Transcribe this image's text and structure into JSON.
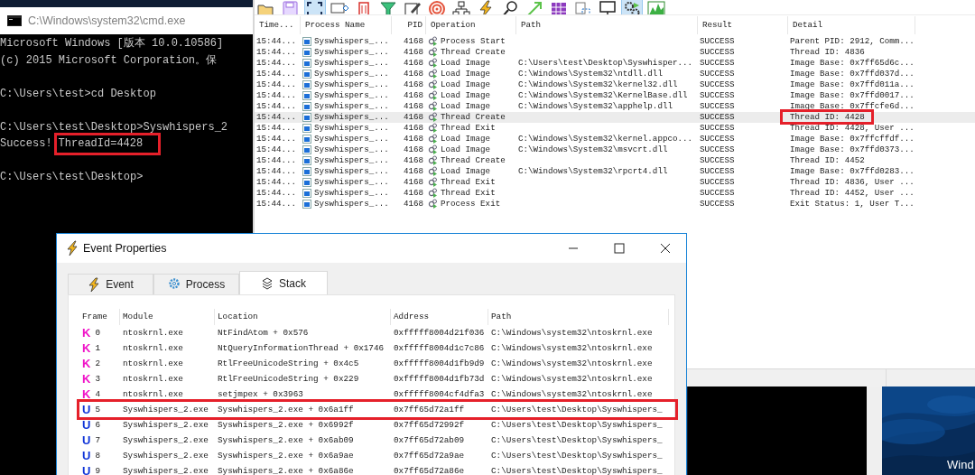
{
  "cmd": {
    "title": "C:\\Windows\\system32\\cmd.exe",
    "blocks": [
      [
        [
          {
            "text": "Microsoft Windows [版本 10.0.10586]",
            "highlighted": false
          }
        ],
        [
          {
            "text": "(c) 2015 Microsoft Corporation。保",
            "highlighted": false
          }
        ]
      ],
      [
        [
          {
            "text": "C:\\Users\\test>cd Desktop",
            "highlighted": false
          }
        ]
      ],
      [
        [
          {
            "text": "C:\\Users\\test\\Desktop>Syswhispers_2",
            "highlighted": false
          }
        ],
        [
          {
            "text": "Success!",
            "highlighted": false
          },
          {
            "text": "ThreadId=4428",
            "highlighted": true
          }
        ]
      ],
      [
        [
          {
            "text": "C:\\Users\\test\\Desktop>",
            "highlighted": false
          }
        ]
      ]
    ]
  },
  "procmon": {
    "toolbar": [
      {
        "kind": "folder",
        "selected": false
      },
      {
        "kind": "save",
        "selected": false
      },
      {
        "kind": "capture",
        "selected": true
      },
      {
        "kind": "autoscroll",
        "selected": false
      },
      {
        "kind": "clear",
        "selected": false
      },
      {
        "kind": "filter",
        "selected": false
      },
      {
        "kind": "highlight",
        "selected": false
      },
      {
        "kind": "target",
        "selected": false
      },
      {
        "kind": "tree",
        "selected": false
      },
      {
        "kind": "events",
        "selected": false
      },
      {
        "kind": "find",
        "selected": false
      },
      {
        "kind": "jump",
        "selected": false
      },
      {
        "kind": "registry",
        "selected": false
      },
      {
        "kind": "files",
        "selected": false
      },
      {
        "kind": "network",
        "selected": false
      },
      {
        "kind": "process",
        "selected": true
      },
      {
        "kind": "profiling",
        "selected": false
      }
    ],
    "columns": [
      "Time...",
      "Process Name",
      "PID",
      "Operation",
      "Path",
      "Result",
      "Detail"
    ],
    "rows": [
      {
        "time": "15:44...",
        "process": "Syswhispers_...",
        "pid": "4168",
        "operation": "Process Start",
        "path": "",
        "result": "SUCCESS",
        "detail": "Parent PID: 2912, Comm...",
        "selected": false,
        "highlighted": false
      },
      {
        "time": "15:44...",
        "process": "Syswhispers_...",
        "pid": "4168",
        "operation": "Thread Create",
        "path": "",
        "result": "SUCCESS",
        "detail": "Thread ID: 4836",
        "selected": false,
        "highlighted": false
      },
      {
        "time": "15:44...",
        "process": "Syswhispers_...",
        "pid": "4168",
        "operation": "Load Image",
        "path": "C:\\Users\\test\\Desktop\\Syswhisper...",
        "result": "SUCCESS",
        "detail": "Image Base: 0x7ff65d6c...",
        "selected": false,
        "highlighted": false
      },
      {
        "time": "15:44...",
        "process": "Syswhispers_...",
        "pid": "4168",
        "operation": "Load Image",
        "path": "C:\\Windows\\System32\\ntdll.dll",
        "result": "SUCCESS",
        "detail": "Image Base: 0x7ffd037d...",
        "selected": false,
        "highlighted": false
      },
      {
        "time": "15:44...",
        "process": "Syswhispers_...",
        "pid": "4168",
        "operation": "Load Image",
        "path": "C:\\Windows\\System32\\kernel32.dll",
        "result": "SUCCESS",
        "detail": "Image Base: 0x7ffd011a...",
        "selected": false,
        "highlighted": false
      },
      {
        "time": "15:44...",
        "process": "Syswhispers_...",
        "pid": "4168",
        "operation": "Load Image",
        "path": "C:\\Windows\\System32\\KernelBase.dll",
        "result": "SUCCESS",
        "detail": "Image Base: 0x7ffd0017...",
        "selected": false,
        "highlighted": false
      },
      {
        "time": "15:44...",
        "process": "Syswhispers_...",
        "pid": "4168",
        "operation": "Load Image",
        "path": "C:\\Windows\\System32\\apphelp.dll",
        "result": "SUCCESS",
        "detail": "Image Base: 0x7ffcfe6d...",
        "selected": false,
        "highlighted": false
      },
      {
        "time": "15:44...",
        "process": "Syswhispers_...",
        "pid": "4168",
        "operation": "Thread Create",
        "path": "",
        "result": "SUCCESS",
        "detail": "Thread ID: 4428",
        "selected": true,
        "highlighted": true
      },
      {
        "time": "15:44...",
        "process": "Syswhispers_...",
        "pid": "4168",
        "operation": "Thread Exit",
        "path": "",
        "result": "SUCCESS",
        "detail": "Thread ID: 4428, User ...",
        "selected": false,
        "highlighted": false
      },
      {
        "time": "15:44...",
        "process": "Syswhispers_...",
        "pid": "4168",
        "operation": "Load Image",
        "path": "C:\\Windows\\System32\\kernel.appco...",
        "result": "SUCCESS",
        "detail": "Image Base: 0x7ffcffdf...",
        "selected": false,
        "highlighted": false
      },
      {
        "time": "15:44...",
        "process": "Syswhispers_...",
        "pid": "4168",
        "operation": "Load Image",
        "path": "C:\\Windows\\System32\\msvcrt.dll",
        "result": "SUCCESS",
        "detail": "Image Base: 0x7ffd0373...",
        "selected": false,
        "highlighted": false
      },
      {
        "time": "15:44...",
        "process": "Syswhispers_...",
        "pid": "4168",
        "operation": "Thread Create",
        "path": "",
        "result": "SUCCESS",
        "detail": "Thread ID: 4452",
        "selected": false,
        "highlighted": false
      },
      {
        "time": "15:44...",
        "process": "Syswhispers_...",
        "pid": "4168",
        "operation": "Load Image",
        "path": "C:\\Windows\\System32\\rpcrt4.dll",
        "result": "SUCCESS",
        "detail": "Image Base: 0x7ffd0283...",
        "selected": false,
        "highlighted": false
      },
      {
        "time": "15:44...",
        "process": "Syswhispers_...",
        "pid": "4168",
        "operation": "Thread Exit",
        "path": "",
        "result": "SUCCESS",
        "detail": "Thread ID: 4836, User ...",
        "selected": false,
        "highlighted": false
      },
      {
        "time": "15:44...",
        "process": "Syswhispers_...",
        "pid": "4168",
        "operation": "Thread Exit",
        "path": "",
        "result": "SUCCESS",
        "detail": "Thread ID: 4452, User ...",
        "selected": false,
        "highlighted": false
      },
      {
        "time": "15:44...",
        "process": "Syswhispers_...",
        "pid": "4168",
        "operation": "Process Exit",
        "path": "",
        "result": "SUCCESS",
        "detail": "Exit Status: 1, User T...",
        "selected": false,
        "highlighted": false
      }
    ]
  },
  "event_properties": {
    "title": "Event Properties",
    "tabs": [
      {
        "label": "Event",
        "kind": "event",
        "selected": false
      },
      {
        "label": "Process",
        "kind": "process",
        "selected": false
      },
      {
        "label": "Stack",
        "kind": "stack",
        "selected": true
      }
    ],
    "columns": [
      "Frame",
      "Module",
      "Location",
      "Address",
      "Path"
    ],
    "rows": [
      {
        "kind": "kernel",
        "mode": "K",
        "frame": "0",
        "module": "ntoskrnl.exe",
        "location": "NtFindAtom + 0x576",
        "address": "0xfffff8004d21f036",
        "path": "C:\\Windows\\system32\\ntoskrnl.exe",
        "highlighted": false
      },
      {
        "kind": "kernel",
        "mode": "K",
        "frame": "1",
        "module": "ntoskrnl.exe",
        "location": "NtQueryInformationThread + 0x1746",
        "address": "0xfffff8004d1c7c86",
        "path": "C:\\Windows\\system32\\ntoskrnl.exe",
        "highlighted": false
      },
      {
        "kind": "kernel",
        "mode": "K",
        "frame": "2",
        "module": "ntoskrnl.exe",
        "location": "RtlFreeUnicodeString + 0x4c5",
        "address": "0xfffff8004d1fb9d9",
        "path": "C:\\Windows\\system32\\ntoskrnl.exe",
        "highlighted": false
      },
      {
        "kind": "kernel",
        "mode": "K",
        "frame": "3",
        "module": "ntoskrnl.exe",
        "location": "RtlFreeUnicodeString + 0x229",
        "address": "0xfffff8004d1fb73d",
        "path": "C:\\Windows\\system32\\ntoskrnl.exe",
        "highlighted": false
      },
      {
        "kind": "kernel",
        "mode": "K",
        "frame": "4",
        "module": "ntoskrnl.exe",
        "location": "setjmpex + 0x3963",
        "address": "0xfffff8004cf4dfa3",
        "path": "C:\\Windows\\system32\\ntoskrnl.exe",
        "highlighted": false
      },
      {
        "kind": "user",
        "mode": "U",
        "frame": "5",
        "module": "Syswhispers_2.exe",
        "location": "Syswhispers_2.exe + 0x6a1ff",
        "address": "0x7ff65d72a1ff",
        "path": "C:\\Users\\test\\Desktop\\Syswhispers_",
        "highlighted": true
      },
      {
        "kind": "user",
        "mode": "U",
        "frame": "6",
        "module": "Syswhispers_2.exe",
        "location": "Syswhispers_2.exe + 0x6992f",
        "address": "0x7ff65d72992f",
        "path": "C:\\Users\\test\\Desktop\\Syswhispers_",
        "highlighted": false
      },
      {
        "kind": "user",
        "mode": "U",
        "frame": "7",
        "module": "Syswhispers_2.exe",
        "location": "Syswhispers_2.exe + 0x6ab09",
        "address": "0x7ff65d72ab09",
        "path": "C:\\Users\\test\\Desktop\\Syswhispers_",
        "highlighted": false
      },
      {
        "kind": "user",
        "mode": "U",
        "frame": "8",
        "module": "Syswhispers_2.exe",
        "location": "Syswhispers_2.exe + 0x6a9ae",
        "address": "0x7ff65d72a9ae",
        "path": "C:\\Users\\test\\Desktop\\Syswhispers_",
        "highlighted": false
      },
      {
        "kind": "user",
        "mode": "U",
        "frame": "9",
        "module": "Syswhispers_2.exe",
        "location": "Syswhispers_2.exe + 0x6a86e",
        "address": "0x7ff65d72a86e",
        "path": "C:\\Users\\test\\Desktop\\Syswhispers_",
        "highlighted": false
      }
    ]
  },
  "desktop_preview": {
    "kind": "picture",
    "caption": "Wind"
  }
}
